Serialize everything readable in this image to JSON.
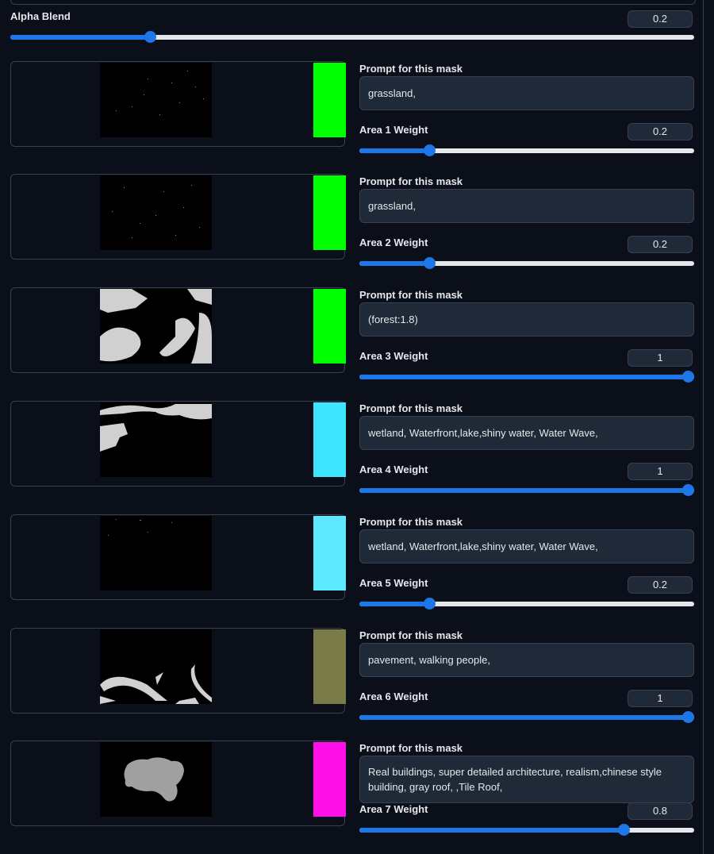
{
  "alpha_blend": {
    "label": "Alpha Blend",
    "value": "0.2",
    "fraction": 0.2
  },
  "prompt_label": "Prompt for this mask",
  "areas": [
    {
      "weight_label": "Area 1 Weight",
      "weight_value": "0.2",
      "fraction": 0.2,
      "prompt": "grassland,",
      "color": "#00ff00",
      "mask": "sparse-dots-a"
    },
    {
      "weight_label": "Area 2 Weight",
      "weight_value": "0.2",
      "fraction": 0.2,
      "prompt": "grassland,",
      "color": "#00ff00",
      "mask": "sparse-dots-b"
    },
    {
      "weight_label": "Area 3 Weight",
      "weight_value": "1",
      "fraction": 1.0,
      "prompt": "(forest:1.8)",
      "color": "#00ff00",
      "mask": "forest-shapes"
    },
    {
      "weight_label": "Area 4 Weight",
      "weight_value": "1",
      "fraction": 1.0,
      "prompt": "wetland, Waterfront,lake,shiny water, Water Wave,",
      "color": "#3ee5ff",
      "mask": "water-shapes"
    },
    {
      "weight_label": "Area 5 Weight",
      "weight_value": "0.2",
      "fraction": 0.2,
      "prompt": "wetland, Waterfront,lake,shiny water, Water Wave,",
      "color": "#5ee8ff",
      "mask": "few-dots"
    },
    {
      "weight_label": "Area 6 Weight",
      "weight_value": "1",
      "fraction": 1.0,
      "prompt": "pavement, walking people,",
      "color": "#7b7b4a",
      "mask": "path-shapes"
    },
    {
      "weight_label": "Area 7 Weight",
      "weight_value": "0.8",
      "fraction": 0.8,
      "prompt": "Real buildings, super detailed architecture, realism,chinese style building, gray roof, ,Tile Roof,",
      "color": "#ff10e8",
      "mask": "building-blob"
    }
  ]
}
